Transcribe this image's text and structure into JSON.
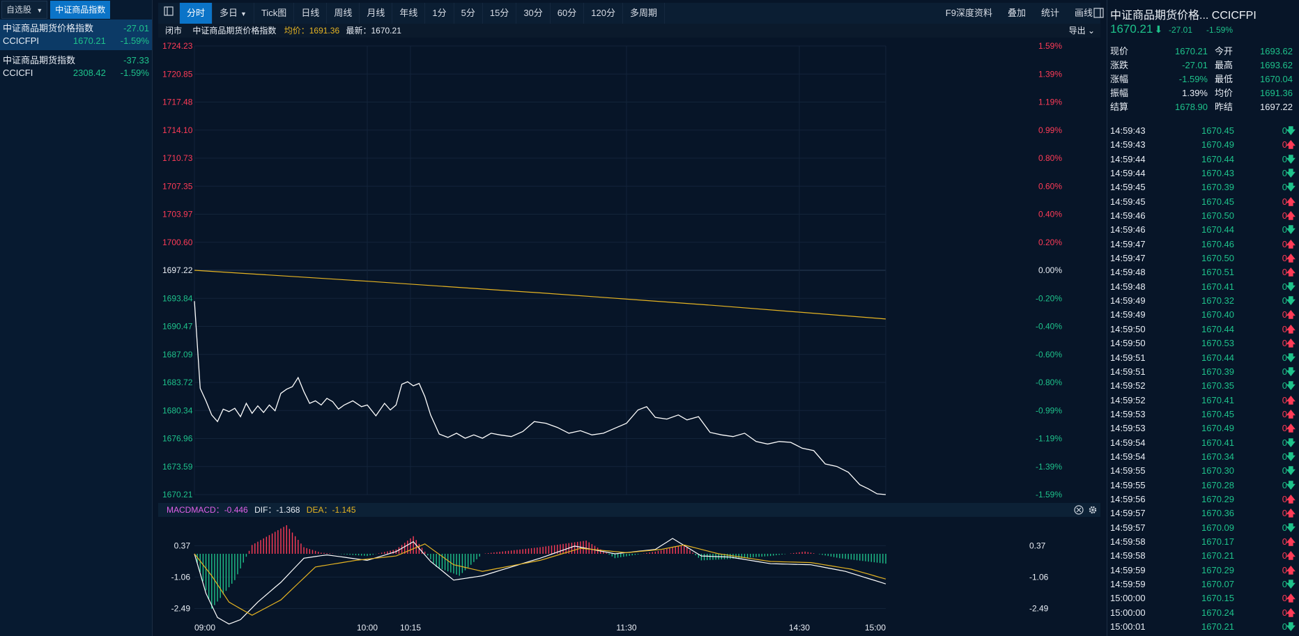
{
  "left_panel": {
    "tabs": [
      {
        "label": "自选股"
      },
      {
        "label": "中证商品指数"
      }
    ],
    "items": [
      {
        "name": "中证商品期货价格指数",
        "change": "-27.01",
        "code": "CCICFPI",
        "price": "1670.21",
        "pct": "-1.59%"
      },
      {
        "name": "中证商品期货指数",
        "change": "-37.33",
        "code": "CCICFI",
        "price": "2308.42",
        "pct": "-1.59%"
      }
    ]
  },
  "toolbar": {
    "periods": [
      {
        "label": "分时"
      },
      {
        "label": "多日"
      },
      {
        "label": "Tick图"
      },
      {
        "label": "日线"
      },
      {
        "label": "周线"
      },
      {
        "label": "月线"
      },
      {
        "label": "年线"
      },
      {
        "label": "1分"
      },
      {
        "label": "5分"
      },
      {
        "label": "15分"
      },
      {
        "label": "30分"
      },
      {
        "label": "60分"
      },
      {
        "label": "120分"
      },
      {
        "label": "多周期"
      }
    ],
    "right_buttons": [
      {
        "label": "F9深度资料"
      },
      {
        "label": "叠加"
      },
      {
        "label": "统计"
      },
      {
        "label": "画线"
      }
    ]
  },
  "infobar": {
    "status": "闭市",
    "name": "中证商品期货价格指数",
    "avg_label": "均价：",
    "avg_value": "1691.36",
    "last_label": "最新：",
    "last_value": "1670.21",
    "export": "导出"
  },
  "chart_data": [
    {
      "type": "line",
      "title": "中证商品期货价格指数",
      "y_left_ticks": [
        "1724.23",
        "1720.85",
        "1717.48",
        "1714.10",
        "1710.73",
        "1707.35",
        "1703.97",
        "1700.60",
        "1697.22",
        "1693.84",
        "1690.47",
        "1687.09",
        "1683.72",
        "1680.34",
        "1676.96",
        "1673.59",
        "1670.21"
      ],
      "y_right_ticks": [
        "1.59%",
        "1.39%",
        "1.19%",
        "0.99%",
        "0.80%",
        "0.60%",
        "0.40%",
        "0.20%",
        "0.00%",
        "-0.20%",
        "-0.40%",
        "-0.60%",
        "-0.80%",
        "-0.99%",
        "-1.19%",
        "-1.39%",
        "-1.59%"
      ],
      "ylim": [
        1670.21,
        1724.23
      ],
      "pre_close": 1697.22,
      "x_ticks": [
        "09:00",
        "10:00",
        "10:15",
        "11:30",
        "14:30",
        "15:00"
      ],
      "series": [
        {
          "role": "price",
          "color": "#ffffff",
          "points": [
            [
              0,
              1693.5
            ],
            [
              2,
              1683.0
            ],
            [
              4,
              1681.5
            ],
            [
              6,
              1679.8
            ],
            [
              8,
              1679.0
            ],
            [
              10,
              1680.5
            ],
            [
              12,
              1680.2
            ],
            [
              14,
              1680.6
            ],
            [
              16,
              1679.6
            ],
            [
              18,
              1681.2
            ],
            [
              20,
              1680.0
            ],
            [
              22,
              1680.9
            ],
            [
              24,
              1680.1
            ],
            [
              26,
              1681.0
            ],
            [
              28,
              1680.3
            ],
            [
              30,
              1682.4
            ],
            [
              32,
              1682.9
            ],
            [
              34,
              1683.2
            ],
            [
              36,
              1684.3
            ],
            [
              38,
              1682.6
            ],
            [
              40,
              1681.2
            ],
            [
              42,
              1681.5
            ],
            [
              44,
              1681.0
            ],
            [
              46,
              1681.8
            ],
            [
              48,
              1681.4
            ],
            [
              50,
              1680.5
            ],
            [
              52,
              1681.0
            ],
            [
              55,
              1681.5
            ],
            [
              58,
              1680.8
            ],
            [
              60,
              1681.0
            ],
            [
              63,
              1679.7
            ],
            [
              66,
              1681.2
            ],
            [
              68,
              1680.4
            ],
            [
              70,
              1681.0
            ],
            [
              72,
              1683.5
            ],
            [
              74,
              1683.8
            ],
            [
              76,
              1683.3
            ],
            [
              78,
              1683.6
            ],
            [
              80,
              1682.0
            ],
            [
              82,
              1679.8
            ],
            [
              85,
              1677.5
            ],
            [
              88,
              1677.1
            ],
            [
              91,
              1677.6
            ],
            [
              94,
              1677.0
            ],
            [
              97,
              1677.4
            ],
            [
              100,
              1677.0
            ],
            [
              103,
              1677.6
            ],
            [
              106,
              1677.4
            ],
            [
              110,
              1677.2
            ],
            [
              114,
              1677.8
            ],
            [
              118,
              1679.0
            ],
            [
              122,
              1678.8
            ],
            [
              126,
              1678.3
            ],
            [
              130,
              1677.6
            ],
            [
              134,
              1677.9
            ],
            [
              138,
              1677.4
            ],
            [
              142,
              1677.6
            ],
            [
              146,
              1678.2
            ],
            [
              150,
              1678.8
            ],
            [
              154,
              1680.4
            ],
            [
              157,
              1680.8
            ],
            [
              160,
              1679.5
            ],
            [
              164,
              1679.3
            ],
            [
              168,
              1679.8
            ],
            [
              171,
              1679.2
            ],
            [
              175,
              1679.6
            ],
            [
              179,
              1677.7
            ],
            [
              183,
              1677.4
            ],
            [
              187,
              1677.2
            ],
            [
              191,
              1677.6
            ],
            [
              195,
              1676.6
            ],
            [
              199,
              1676.3
            ],
            [
              203,
              1676.6
            ],
            [
              207,
              1676.5
            ],
            [
              211,
              1675.8
            ],
            [
              215,
              1675.5
            ],
            [
              219,
              1673.9
            ],
            [
              223,
              1673.6
            ],
            [
              227,
              1672.9
            ],
            [
              231,
              1671.4
            ],
            [
              234,
              1670.9
            ],
            [
              237,
              1670.3
            ],
            [
              240,
              1670.21
            ]
          ]
        },
        {
          "role": "average",
          "color": "#e6b422",
          "points": [
            [
              0,
              1697.22
            ],
            [
              60,
              1695.9
            ],
            [
              120,
              1694.5
            ],
            [
              180,
              1693.0
            ],
            [
              240,
              1691.36
            ]
          ]
        }
      ]
    },
    {
      "type": "bar",
      "title": "MACD",
      "indicators": {
        "macd_label": "MACD：",
        "macd": "-0.446",
        "dif_label": "DIF：",
        "dif": "-1.368",
        "dea_label": "DEA：",
        "dea": "-1.145"
      },
      "y_ticks": [
        "0.37",
        "-1.06",
        "-2.49"
      ],
      "ylim": [
        -3.3,
        1.3
      ],
      "histogram_anchor": [
        [
          0,
          0.0
        ],
        [
          6,
          -2.5
        ],
        [
          14,
          -1.2
        ],
        [
          20,
          0.4
        ],
        [
          32,
          1.3
        ],
        [
          38,
          0.3
        ],
        [
          44,
          0.05
        ],
        [
          60,
          -0.1
        ],
        [
          70,
          0.2
        ],
        [
          76,
          0.8
        ],
        [
          84,
          -0.6
        ],
        [
          92,
          -1.0
        ],
        [
          100,
          0.0
        ],
        [
          120,
          0.3
        ],
        [
          136,
          0.6
        ],
        [
          146,
          -0.2
        ],
        [
          160,
          0.1
        ],
        [
          170,
          0.4
        ],
        [
          176,
          -0.3
        ],
        [
          184,
          -0.25
        ],
        [
          200,
          -0.1
        ],
        [
          212,
          0.1
        ],
        [
          224,
          -0.2
        ],
        [
          240,
          -0.45
        ]
      ],
      "dif_anchor": [
        [
          0,
          0.0
        ],
        [
          4,
          -1.8
        ],
        [
          8,
          -2.9
        ],
        [
          12,
          -3.2
        ],
        [
          16,
          -3.0
        ],
        [
          22,
          -2.2
        ],
        [
          30,
          -1.3
        ],
        [
          38,
          -0.2
        ],
        [
          46,
          -0.05
        ],
        [
          60,
          -0.3
        ],
        [
          70,
          0.1
        ],
        [
          76,
          0.55
        ],
        [
          82,
          -0.35
        ],
        [
          90,
          -1.2
        ],
        [
          100,
          -1.0
        ],
        [
          120,
          -0.2
        ],
        [
          132,
          0.35
        ],
        [
          146,
          0.0
        ],
        [
          160,
          0.2
        ],
        [
          166,
          0.7
        ],
        [
          176,
          -0.1
        ],
        [
          186,
          -0.15
        ],
        [
          200,
          -0.45
        ],
        [
          214,
          -0.5
        ],
        [
          226,
          -0.8
        ],
        [
          240,
          -1.37
        ]
      ],
      "dea_anchor": [
        [
          0,
          0.0
        ],
        [
          6,
          -1.0
        ],
        [
          12,
          -2.2
        ],
        [
          20,
          -2.8
        ],
        [
          30,
          -2.1
        ],
        [
          42,
          -0.6
        ],
        [
          56,
          -0.3
        ],
        [
          70,
          -0.1
        ],
        [
          80,
          0.45
        ],
        [
          90,
          -0.5
        ],
        [
          100,
          -0.8
        ],
        [
          120,
          -0.3
        ],
        [
          134,
          0.25
        ],
        [
          150,
          0.05
        ],
        [
          162,
          0.2
        ],
        [
          170,
          0.4
        ],
        [
          182,
          0.0
        ],
        [
          200,
          -0.35
        ],
        [
          214,
          -0.4
        ],
        [
          228,
          -0.7
        ],
        [
          240,
          -1.15
        ]
      ]
    }
  ],
  "right_panel": {
    "title": "中证商品期货价格... CCICFPI",
    "price": "1670.21",
    "change": "-27.01",
    "pct": "-1.59%",
    "quote": [
      {
        "l1": "现价",
        "v1": "1670.21",
        "c1": "green",
        "l2": "今开",
        "v2": "1693.62",
        "c2": "green"
      },
      {
        "l1": "涨跌",
        "v1": "-27.01",
        "c1": "green",
        "l2": "最高",
        "v2": "1693.62",
        "c2": "green"
      },
      {
        "l1": "涨幅",
        "v1": "-1.59%",
        "c1": "green",
        "l2": "最低",
        "v2": "1670.04",
        "c2": "green"
      },
      {
        "l1": "振幅",
        "v1": "1.39%",
        "c1": "white",
        "l2": "均价",
        "v2": "1691.36",
        "c2": "green"
      },
      {
        "l1": "结算",
        "v1": "1678.90",
        "c1": "green",
        "l2": "昨结",
        "v2": "1697.22",
        "c2": "white"
      }
    ],
    "ticks": [
      {
        "t": "14:59:43",
        "p": "1670.45",
        "v": "0",
        "d": "down"
      },
      {
        "t": "14:59:43",
        "p": "1670.49",
        "v": "0",
        "d": "up"
      },
      {
        "t": "14:59:44",
        "p": "1670.44",
        "v": "0",
        "d": "down"
      },
      {
        "t": "14:59:44",
        "p": "1670.43",
        "v": "0",
        "d": "down"
      },
      {
        "t": "14:59:45",
        "p": "1670.39",
        "v": "0",
        "d": "down"
      },
      {
        "t": "14:59:45",
        "p": "1670.45",
        "v": "0",
        "d": "up"
      },
      {
        "t": "14:59:46",
        "p": "1670.50",
        "v": "0",
        "d": "up"
      },
      {
        "t": "14:59:46",
        "p": "1670.44",
        "v": "0",
        "d": "down"
      },
      {
        "t": "14:59:47",
        "p": "1670.46",
        "v": "0",
        "d": "up"
      },
      {
        "t": "14:59:47",
        "p": "1670.50",
        "v": "0",
        "d": "up"
      },
      {
        "t": "14:59:48",
        "p": "1670.51",
        "v": "0",
        "d": "up"
      },
      {
        "t": "14:59:48",
        "p": "1670.41",
        "v": "0",
        "d": "down"
      },
      {
        "t": "14:59:49",
        "p": "1670.32",
        "v": "0",
        "d": "down"
      },
      {
        "t": "14:59:49",
        "p": "1670.40",
        "v": "0",
        "d": "up"
      },
      {
        "t": "14:59:50",
        "p": "1670.44",
        "v": "0",
        "d": "up"
      },
      {
        "t": "14:59:50",
        "p": "1670.53",
        "v": "0",
        "d": "up"
      },
      {
        "t": "14:59:51",
        "p": "1670.44",
        "v": "0",
        "d": "down"
      },
      {
        "t": "14:59:51",
        "p": "1670.39",
        "v": "0",
        "d": "down"
      },
      {
        "t": "14:59:52",
        "p": "1670.35",
        "v": "0",
        "d": "down"
      },
      {
        "t": "14:59:52",
        "p": "1670.41",
        "v": "0",
        "d": "up"
      },
      {
        "t": "14:59:53",
        "p": "1670.45",
        "v": "0",
        "d": "up"
      },
      {
        "t": "14:59:53",
        "p": "1670.49",
        "v": "0",
        "d": "up"
      },
      {
        "t": "14:59:54",
        "p": "1670.41",
        "v": "0",
        "d": "down"
      },
      {
        "t": "14:59:54",
        "p": "1670.34",
        "v": "0",
        "d": "down"
      },
      {
        "t": "14:59:55",
        "p": "1670.30",
        "v": "0",
        "d": "down"
      },
      {
        "t": "14:59:55",
        "p": "1670.28",
        "v": "0",
        "d": "down"
      },
      {
        "t": "14:59:56",
        "p": "1670.29",
        "v": "0",
        "d": "up"
      },
      {
        "t": "14:59:57",
        "p": "1670.36",
        "v": "0",
        "d": "up"
      },
      {
        "t": "14:59:57",
        "p": "1670.09",
        "v": "0",
        "d": "down"
      },
      {
        "t": "14:59:58",
        "p": "1670.17",
        "v": "0",
        "d": "up"
      },
      {
        "t": "14:59:58",
        "p": "1670.21",
        "v": "0",
        "d": "up"
      },
      {
        "t": "14:59:59",
        "p": "1670.29",
        "v": "0",
        "d": "up"
      },
      {
        "t": "14:59:59",
        "p": "1670.07",
        "v": "0",
        "d": "down"
      },
      {
        "t": "15:00:00",
        "p": "1670.15",
        "v": "0",
        "d": "up"
      },
      {
        "t": "15:00:00",
        "p": "1670.24",
        "v": "0",
        "d": "up"
      },
      {
        "t": "15:00:01",
        "p": "1670.21",
        "v": "0",
        "d": "down"
      }
    ]
  },
  "colors": {
    "up": "#ff3b57",
    "down": "#1ec28b",
    "accent": "#0b74c8",
    "avg": "#e6b422"
  }
}
